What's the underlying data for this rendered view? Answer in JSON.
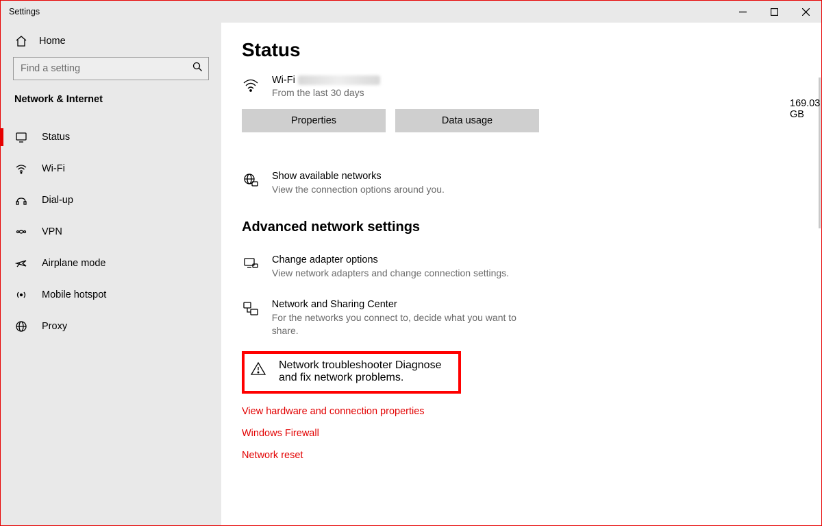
{
  "window": {
    "title": "Settings"
  },
  "sidebar": {
    "home": "Home",
    "search_placeholder": "Find a setting",
    "section": "Network & Internet",
    "items": [
      {
        "label": "Status"
      },
      {
        "label": "Wi-Fi"
      },
      {
        "label": "Dial-up"
      },
      {
        "label": "VPN"
      },
      {
        "label": "Airplane mode"
      },
      {
        "label": "Mobile hotspot"
      },
      {
        "label": "Proxy"
      }
    ]
  },
  "main": {
    "title": "Status",
    "wifi": {
      "name": "Wi-Fi",
      "subtitle": "From the last 30 days",
      "data_amount": "169.03 GB",
      "btn_properties": "Properties",
      "btn_data_usage": "Data usage"
    },
    "available": {
      "title": "Show available networks",
      "sub": "View the connection options around you."
    },
    "advanced_header": "Advanced network settings",
    "adapter": {
      "title": "Change adapter options",
      "sub": "View network adapters and change connection settings."
    },
    "sharing": {
      "title": "Network and Sharing Center",
      "sub": "For the networks you connect to, decide what you want to share."
    },
    "troubleshoot": {
      "title": "Network troubleshooter",
      "sub": "Diagnose and fix network problems."
    },
    "links": {
      "hardware": "View hardware and connection properties",
      "firewall": "Windows Firewall",
      "reset": "Network reset"
    }
  }
}
